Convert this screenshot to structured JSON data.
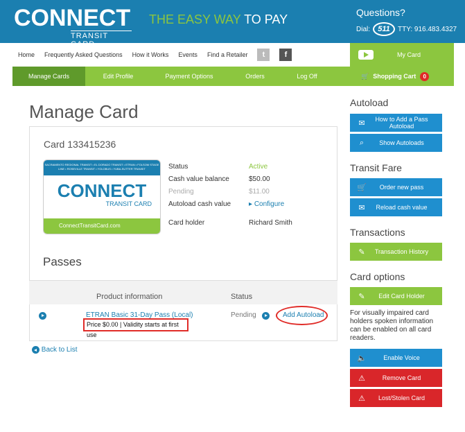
{
  "header": {
    "logo_main": "CONNECT",
    "logo_sub": "TRANSIT CARD",
    "tagline_green": "THE EASY WAY",
    "tagline_white": "TO PAY",
    "questions": "Questions?",
    "dial_label": "Dial:",
    "dial_511": "511",
    "tty": "TTY: 916.483.4327"
  },
  "topnav": {
    "items": [
      "Home",
      "Frequently Asked Questions",
      "How it Works",
      "Events",
      "Find a Retailer"
    ],
    "twitter": "t",
    "facebook": "f"
  },
  "mainnav": {
    "tabs": [
      "Manage Cards",
      "Edit Profile",
      "Payment Options",
      "Orders",
      "Log Off"
    ]
  },
  "account": {
    "my_card": "My Card",
    "shopping_cart": "Shopping Cart",
    "cart_count": "0"
  },
  "page": {
    "title": "Manage Card",
    "card_number": "Card 133415236"
  },
  "card_image": {
    "top_text": "SACRAMENTO REGIONAL TRANSIT • EL DORADO TRANSIT • ETRAN • FOLSOM STAGE LINE • ROSEVILLE TRANSIT • YOLOBUS • YUBA-SUTTER TRANSIT",
    "brand": "CONNECT",
    "brand_sub": "TRANSIT CARD",
    "website": "ConnectTransitCard.com"
  },
  "card_info": {
    "status_label": "Status",
    "status_value": "Active",
    "cash_label": "Cash value balance",
    "cash_value": "$50.00",
    "pending_label": "Pending",
    "pending_value": "$11.00",
    "autoload_label": "Autoload cash value",
    "autoload_value": "Configure",
    "holder_label": "Card holder",
    "holder_value": "Richard Smith"
  },
  "passes": {
    "title": "Passes",
    "col_product": "Product information",
    "col_status": "Status",
    "rows": [
      {
        "product": "ETRAN Basic 31-Day Pass (Local)",
        "details": "Price $0.00 | Validity starts at first use",
        "status": "Pending",
        "action": "Add Autoload"
      }
    ]
  },
  "back_link": "Back to List",
  "sidebar": {
    "autoload_title": "Autoload",
    "how_to_autoload": "How to Add a Pass Autoload",
    "show_autoloads": "Show Autoloads",
    "fare_title": "Transit Fare",
    "order_pass": "Order new pass",
    "reload_cash": "Reload cash value",
    "transactions_title": "Transactions",
    "transaction_history": "Transaction History",
    "card_options_title": "Card options",
    "edit_holder": "Edit Card Holder",
    "impaired_text": "For visually impaired card holders spoken information can be enabled on all card readers.",
    "enable_voice": "Enable Voice",
    "remove_card": "Remove Card",
    "lost_stolen": "Lost/Stolen Card"
  },
  "colors": {
    "brand_blue": "#1b7fb0",
    "brand_green": "#8cc63f",
    "alert_red": "#d9262a"
  }
}
